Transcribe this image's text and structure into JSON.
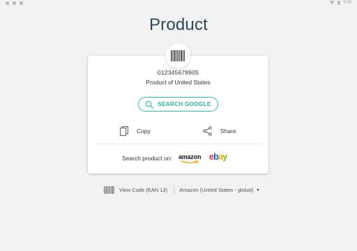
{
  "status_bar": {
    "time": "6:00"
  },
  "page": {
    "title": "Product"
  },
  "product": {
    "code": "012345678905",
    "description": "Product of United States"
  },
  "actions": {
    "search_label": "SEARCH GOOGLE",
    "copy_label": "Copy",
    "share_label": "Share"
  },
  "stores": {
    "label": "Search product on:",
    "amazon": "amazon",
    "ebay": {
      "e": "e",
      "b": "b",
      "a": "a",
      "y": "y"
    }
  },
  "footer": {
    "view_code_label": "View Code (EAN 13)",
    "store_select": "Amazon (United States - global)"
  },
  "colors": {
    "accent": "#2cbfae",
    "title": "#2f4858",
    "ebay_e": "#e53238",
    "ebay_b": "#0064d2",
    "ebay_a": "#f5af02",
    "ebay_y": "#86b817",
    "amazon_smile": "#ff9900"
  }
}
